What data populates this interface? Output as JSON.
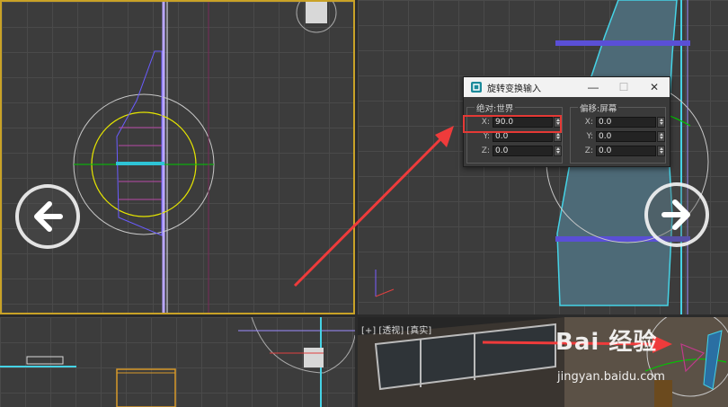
{
  "dialog": {
    "title": "旋转变换输入",
    "minimize": "—",
    "maximize": "☐",
    "close": "✕",
    "absolute_group": {
      "legend": "绝对:世界",
      "x_label": "X:",
      "x_value": "90.0",
      "y_label": "Y:",
      "y_value": "0.0",
      "z_label": "Z:",
      "z_value": "0.0"
    },
    "offset_group": {
      "legend": "偏移:屏幕",
      "x_label": "X:",
      "x_value": "0.0",
      "y_label": "Y:",
      "y_value": "0.0",
      "z_label": "Z:",
      "z_value": "0.0"
    }
  },
  "viewports": {
    "perspective_label": "[+] [透视] [真实]"
  },
  "watermark": {
    "brand": "Bai 经验",
    "site": "jingyan.baidu.com"
  },
  "colors": {
    "accent_border": "#c9a227",
    "arrow_red": "#ef3b3b",
    "highlight": "#e53935"
  },
  "icons": {
    "nav_left": "arrow-left-icon",
    "nav_right": "arrow-right-icon",
    "app": "3dsmax-icon"
  }
}
